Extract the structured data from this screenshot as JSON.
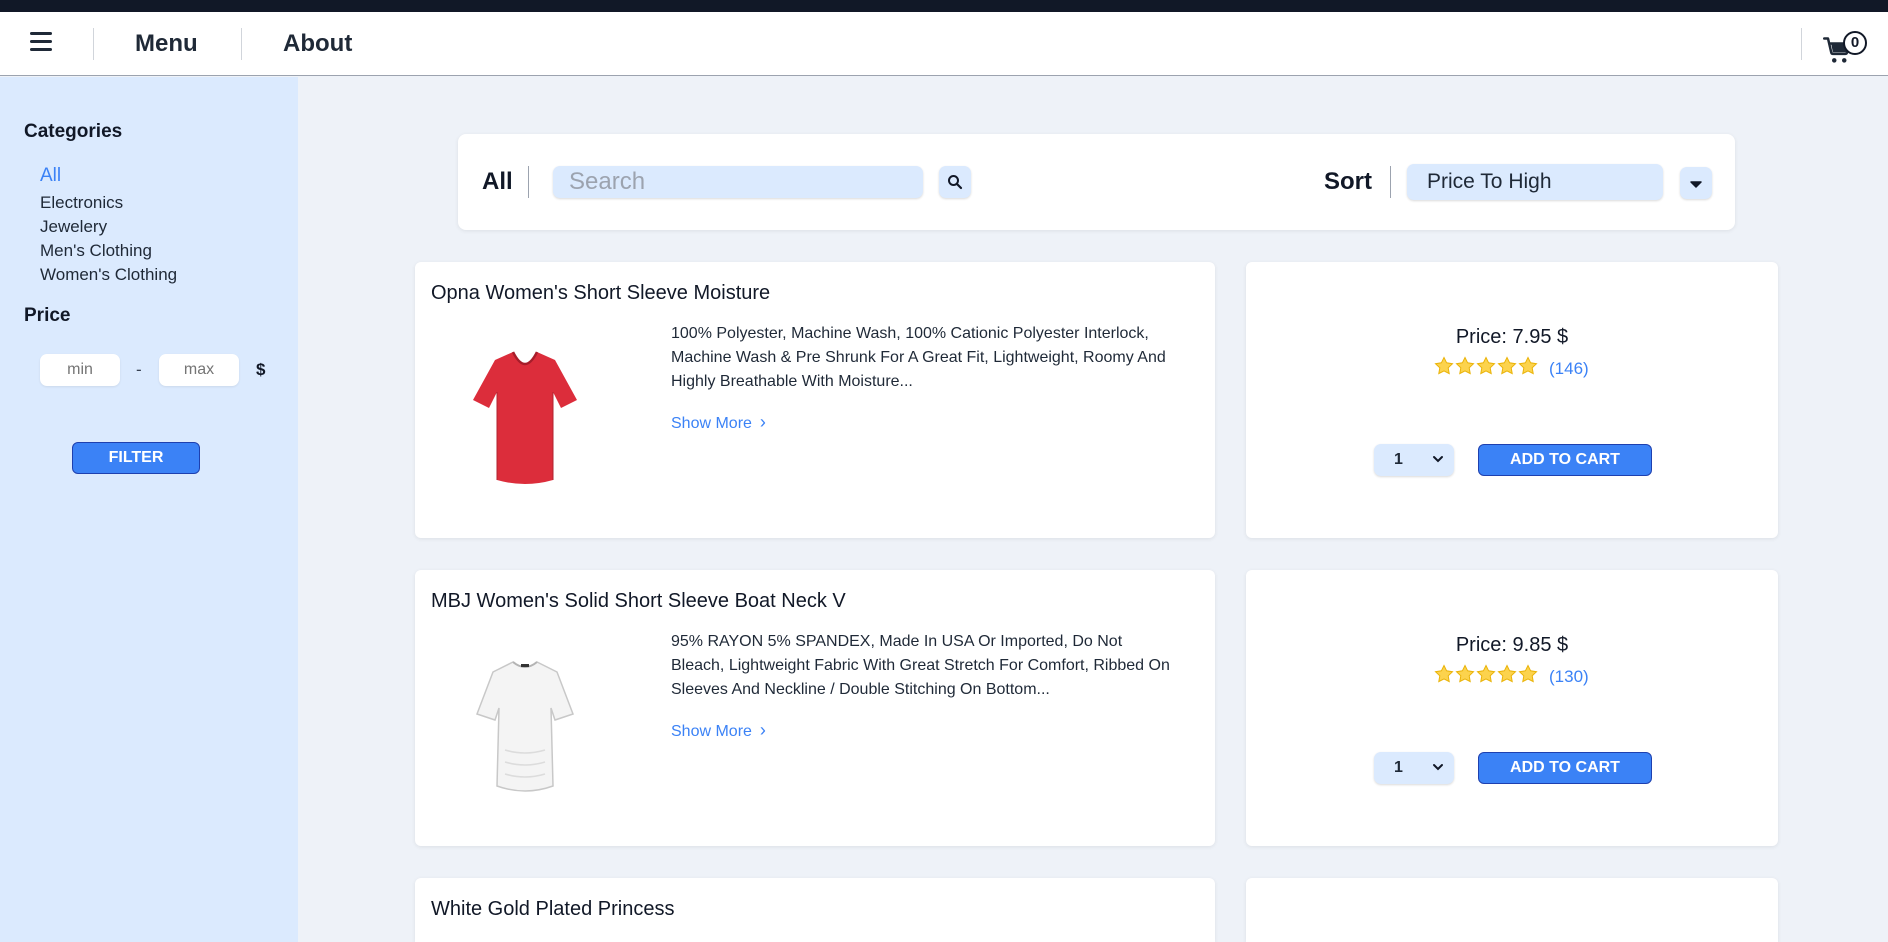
{
  "nav": {
    "menu_label": "Menu",
    "about_label": "About",
    "cart_count": "0"
  },
  "sidebar": {
    "categories_heading": "Categories",
    "categories": [
      "All",
      "Electronics",
      "Jewelery",
      "Men's Clothing",
      "Women's Clothing"
    ],
    "active_category": "All",
    "price_heading": "Price",
    "min_placeholder": "min",
    "max_placeholder": "max",
    "dash": "-",
    "currency": "$",
    "filter_label": "FILTER"
  },
  "toolbar": {
    "category_label": "All",
    "search_placeholder": "Search",
    "sort_label": "Sort",
    "sort_value": "Price To High"
  },
  "products": [
    {
      "title": "Opna Women's Short Sleeve Moisture",
      "description": "100% Polyester, Machine Wash, 100% Cationic Polyester Interlock, Machine Wash & Pre Shrunk For A Great Fit, Lightweight, Roomy And Highly Breathable With Moisture...",
      "show_more": "Show More",
      "price": "Price: 7.95 $",
      "rating_stars": 5,
      "rating_count": "(146)",
      "quantity": "1",
      "add_label": "ADD TO CART",
      "image_color": "#dc2d3b"
    },
    {
      "title": "MBJ Women's Solid Short Sleeve Boat Neck V",
      "description": "95% RAYON 5% SPANDEX, Made In USA Or Imported, Do Not Bleach, Lightweight Fabric With Great Stretch For Comfort, Ribbed On Sleeves And Neckline / Double Stitching On Bottom...",
      "show_more": "Show More",
      "price": "Price: 9.85 $",
      "rating_stars": 5,
      "rating_count": "(130)",
      "quantity": "1",
      "add_label": "ADD TO CART",
      "image_color": "#f5f5f5"
    },
    {
      "title": "White Gold Plated Princess"
    }
  ],
  "colors": {
    "accent": "#3b82f6",
    "sidebar_bg": "#dbeafe",
    "page_bg": "#eef2f8",
    "star": "#fcd34d"
  }
}
